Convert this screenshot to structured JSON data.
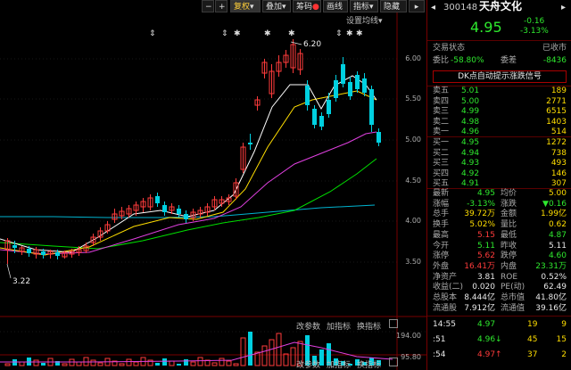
{
  "toolbar": {
    "minus": "−",
    "plus": "+",
    "adjust": "复权",
    "overlay": "叠加",
    "chip": "筹码",
    "draw": "画线",
    "indicator": "指标",
    "hide": "隐藏",
    "ma_setting": "设置均线"
  },
  "chart": {
    "price_axis": [
      "6.00",
      "5.50",
      "5.00",
      "4.50",
      "4.00",
      "3.50"
    ],
    "high_label": "6.20",
    "low_label": "3.22",
    "vol_axis": [
      "194.00",
      "95.80"
    ],
    "sub_buttons_1": [
      "改参数",
      "加指标",
      "换指标"
    ],
    "sub_buttons_2": [
      "改参数",
      "加指标",
      "换指标"
    ]
  },
  "stock": {
    "code": "300148",
    "name": "天舟文化",
    "price": "4.95",
    "change": "-0.16",
    "change_pct": "-3.13%",
    "status_label": "交易状态",
    "status": "已收市",
    "ratio_label": "委比",
    "ratio": "-58.80%",
    "diff_label": "委差",
    "diff": "-8436",
    "signal_title": "DK点自动提示涨跌信号"
  },
  "sells": [
    {
      "label": "卖五",
      "price": "5.01",
      "vol": "189"
    },
    {
      "label": "卖四",
      "price": "5.00",
      "vol": "2771"
    },
    {
      "label": "卖三",
      "price": "4.99",
      "vol": "6515"
    },
    {
      "label": "卖二",
      "price": "4.98",
      "vol": "1403"
    },
    {
      "label": "卖一",
      "price": "4.96",
      "vol": "514"
    }
  ],
  "buys": [
    {
      "label": "买一",
      "price": "4.95",
      "vol": "1272"
    },
    {
      "label": "买二",
      "price": "4.94",
      "vol": "738"
    },
    {
      "label": "买三",
      "price": "4.93",
      "vol": "493"
    },
    {
      "label": "买四",
      "price": "4.92",
      "vol": "146"
    },
    {
      "label": "买五",
      "price": "4.91",
      "vol": "307"
    }
  ],
  "stats": [
    {
      "l1": "最新",
      "v1": "4.95",
      "c1": "grn",
      "l2": "均价",
      "v2": "5.00",
      "c2": "yel"
    },
    {
      "l1": "涨幅",
      "v1": "-3.13%",
      "c1": "grn",
      "l2": "涨跌",
      "v2": "▼0.16",
      "c2": "grn"
    },
    {
      "l1": "总手",
      "v1": "39.72万",
      "c1": "yel",
      "l2": "金额",
      "v2": "1.99亿",
      "c2": "yel"
    },
    {
      "l1": "换手",
      "v1": "5.02%",
      "c1": "yel",
      "l2": "量比",
      "v2": "0.62",
      "c2": "yel"
    },
    {
      "l1": "最高",
      "v1": "5.15",
      "c1": "red",
      "l2": "最低",
      "v2": "4.87",
      "c2": "grn"
    },
    {
      "l1": "今开",
      "v1": "5.11",
      "c1": "grn",
      "l2": "昨收",
      "v2": "5.11",
      "c2": "wht"
    },
    {
      "l1": "涨停",
      "v1": "5.62",
      "c1": "red",
      "l2": "跌停",
      "v2": "4.60",
      "c2": "grn"
    },
    {
      "l1": "外盘",
      "v1": "16.41万",
      "c1": "red",
      "l2": "内盘",
      "v2": "23.31万",
      "c2": "grn"
    },
    {
      "l1": "净资产",
      "v1": "3.81",
      "c1": "wht",
      "l2": "ROE",
      "v2": "0.52%",
      "c2": "wht"
    },
    {
      "l1": "收益(二)",
      "v1": "0.020",
      "c1": "wht",
      "l2": "PE(动)",
      "v2": "62.49",
      "c2": "wht"
    },
    {
      "l1": "总股本",
      "v1": "8.444亿",
      "c1": "wht",
      "l2": "总市值",
      "v2": "41.80亿",
      "c2": "wht"
    },
    {
      "l1": "流通股",
      "v1": "7.912亿",
      "c1": "wht",
      "l2": "流通值",
      "v2": "39.16亿",
      "c2": "wht"
    }
  ],
  "ticks": [
    {
      "time": "14:55",
      "price": "4.97",
      "vol": "19",
      "num": "9"
    },
    {
      "time": ":51",
      "price": "4.96↓",
      "vol": "45",
      "num": "15"
    },
    {
      "time": ":54",
      "price": "4.97↑",
      "vol": "37",
      "num": "2"
    }
  ],
  "colors": {
    "up": "#ff3b3b",
    "down": "#2ee82e",
    "bg": "#000000",
    "ma5": "#ffffff",
    "ma10": "#ffde00",
    "ma20": "#e040e0",
    "ma30": "#00e000",
    "ma60": "#00b4d0"
  }
}
